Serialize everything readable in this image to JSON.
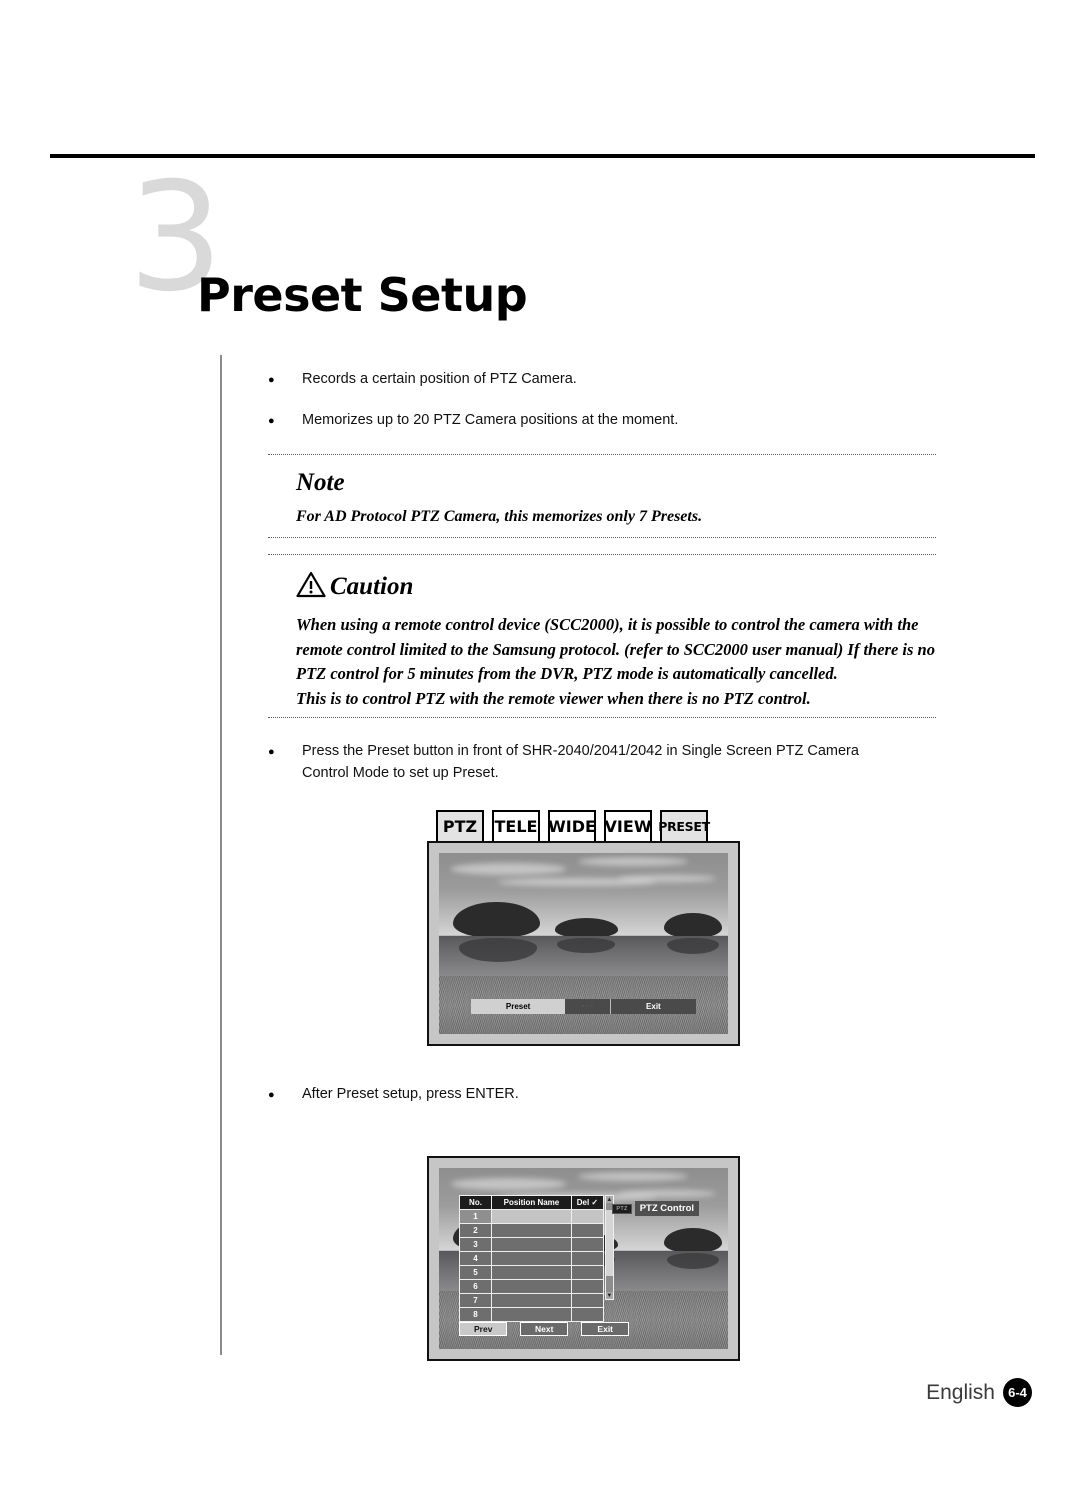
{
  "page": {
    "chapter_number": "3",
    "chapter_title": "Preset Setup"
  },
  "intro_bullets": [
    "Records a certain position of PTZ Camera.",
    "Memorizes up to 20 PTZ Camera positions at the moment."
  ],
  "note": {
    "heading": "Note",
    "body": "For AD Protocol PTZ Camera, this memorizes only 7 Presets."
  },
  "caution": {
    "heading": "Caution",
    "icon": "warning-triangle-icon",
    "body_line1": "When using a remote control device (SCC2000), it is possible to control the camera with the",
    "body_line2": "remote control limited to the Samsung protocol. (refer to SCC2000 user manual) If there is no",
    "body_line3": "PTZ control for 5 minutes from the DVR, PTZ mode is automatically cancelled.",
    "body_line4": "This is to control PTZ with the remote viewer when there is no PTZ control."
  },
  "step_bullets": {
    "preset_line1": "Press the Preset button in front of SHR-2040/2041/2042 in Single Screen PTZ Camera",
    "preset_line2": "Control Mode to set up Preset.",
    "after_preset": "After Preset setup, press ENTER."
  },
  "hardware_buttons": [
    {
      "label": "PTZ",
      "shaded": true
    },
    {
      "label": "TELE",
      "shaded": false
    },
    {
      "label": "WIDE",
      "shaded": false
    },
    {
      "label": "VIEW",
      "shaded": false
    },
    {
      "label": "PRESET",
      "shaded": true
    }
  ],
  "screenshot_one": {
    "osd_preset_label": "Preset",
    "osd_mid_marks": "-     -     -",
    "osd_exit_label": "Exit"
  },
  "screenshot_two": {
    "table_headers": {
      "no": "No.",
      "position_name": "Position Name",
      "del": "Del ✓"
    },
    "rows": [
      {
        "no": "1",
        "position_name": "",
        "del": "",
        "selected": true
      },
      {
        "no": "2",
        "position_name": "",
        "del": "",
        "selected": false
      },
      {
        "no": "3",
        "position_name": "",
        "del": "",
        "selected": false
      },
      {
        "no": "4",
        "position_name": "",
        "del": "",
        "selected": false
      },
      {
        "no": "5",
        "position_name": "",
        "del": "",
        "selected": false
      },
      {
        "no": "6",
        "position_name": "",
        "del": "",
        "selected": false
      },
      {
        "no": "7",
        "position_name": "",
        "del": "",
        "selected": false
      },
      {
        "no": "8",
        "position_name": "",
        "del": "",
        "selected": false
      }
    ],
    "mini_badge": "PTZ",
    "mode_label": "PTZ Control",
    "buttons": [
      {
        "label": "Prev",
        "active": true
      },
      {
        "label": "Next",
        "active": false
      },
      {
        "label": "Exit",
        "active": false
      }
    ],
    "scroll_up": "▲",
    "scroll_down": "▼"
  },
  "footer": {
    "language": "English",
    "page_number": "6-4"
  },
  "colors": {
    "accent_black": "#000000",
    "chapter_gray": "#d9d9d9",
    "rule_gray": "#8b8b8b",
    "button_shade": "#e3e3e3"
  }
}
